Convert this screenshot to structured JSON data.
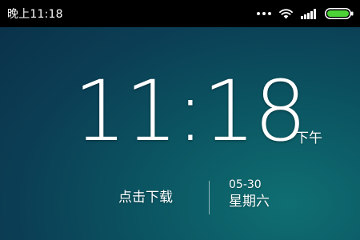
{
  "status_bar": {
    "time": "晚上11:18",
    "icons": [
      "more-dots-icon",
      "wifi-icon",
      "signal-icon",
      "battery-icon"
    ],
    "battery_color": "#4cd137"
  },
  "lock_screen": {
    "time": "11:18",
    "ampm": "下午",
    "download_label": "点击下载",
    "date": "05-30",
    "weekday": "星期六"
  },
  "colors": {
    "status_bar_bg": "#000000",
    "background_top": "#0a2f47",
    "background_bottom": "#0f6f72",
    "text": "#ffffff"
  }
}
